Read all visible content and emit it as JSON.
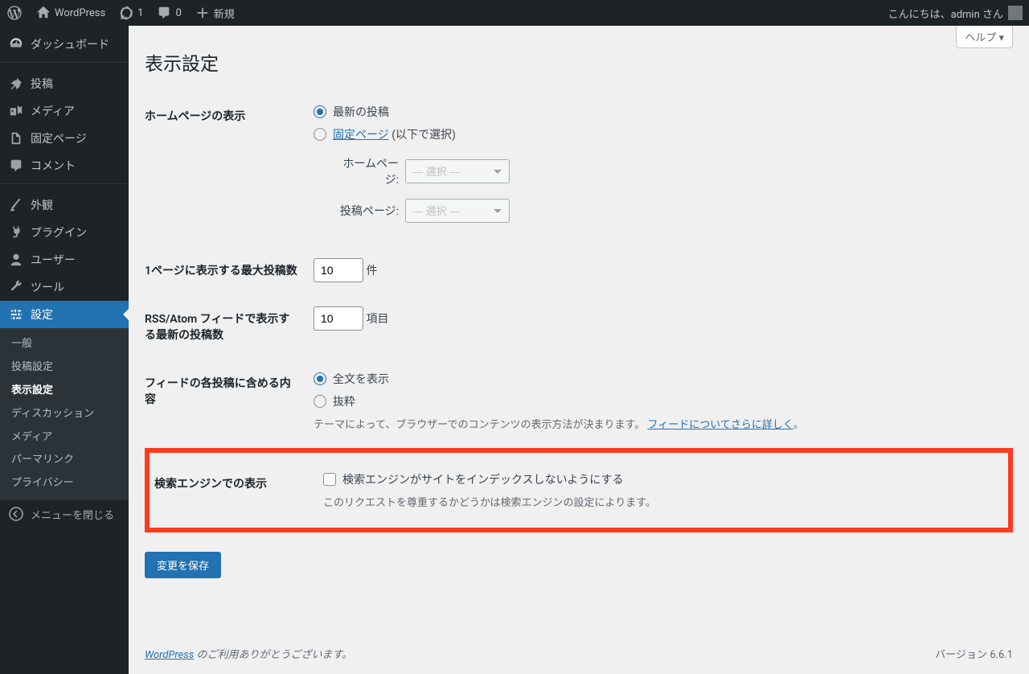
{
  "adminbar": {
    "site_name": "WordPress",
    "updates": "1",
    "comments": "0",
    "new_label": "新規",
    "greeting": "こんにちは、admin さん"
  },
  "menu": {
    "dashboard": "ダッシュボード",
    "posts": "投稿",
    "media": "メディア",
    "pages": "固定ページ",
    "comments": "コメント",
    "appearance": "外観",
    "plugins": "プラグイン",
    "users": "ユーザー",
    "tools": "ツール",
    "settings": "設定",
    "collapse": "メニューを閉じる"
  },
  "submenu": {
    "general": "一般",
    "writing": "投稿設定",
    "reading": "表示設定",
    "discussion": "ディスカッション",
    "media": "メディア",
    "permalink": "パーマリンク",
    "privacy": "プライバシー"
  },
  "help_tab": "ヘルプ ▾",
  "page_title": "表示設定",
  "settings": {
    "homepage": {
      "th": "ホームページの表示",
      "opt_latest": "最新の投稿",
      "opt_static_link": "固定ページ",
      "opt_static_suffix": " (以下で選択)",
      "home_label": "ホームページ:",
      "posts_label": "投稿ページ:",
      "select_placeholder": "— 選択 —"
    },
    "posts_per_page": {
      "th": "1ページに表示する最大投稿数",
      "value": "10",
      "suffix": "件"
    },
    "rss_items": {
      "th": "RSS/Atom フィードで表示する最新の投稿数",
      "value": "10",
      "suffix": "項目"
    },
    "feed_content": {
      "th": "フィードの各投稿に含める内容",
      "opt_full": "全文を表示",
      "opt_excerpt": "抜粋",
      "desc_prefix": "テーマによって、ブラウザーでのコンテンツの表示方法が決まります。",
      "desc_link": "フィードについてさらに詳しく",
      "desc_suffix": "。"
    },
    "search_engine": {
      "th": "検索エンジンでの表示",
      "checkbox_label": "検索エンジンがサイトをインデックスしないようにする",
      "desc": "このリクエストを尊重するかどうかは検索エンジンの設定によります。"
    },
    "submit": "変更を保存"
  },
  "footer": {
    "link": "WordPress",
    "thanks": " のご利用ありがとうございます。",
    "version": "バージョン 6.6.1"
  }
}
